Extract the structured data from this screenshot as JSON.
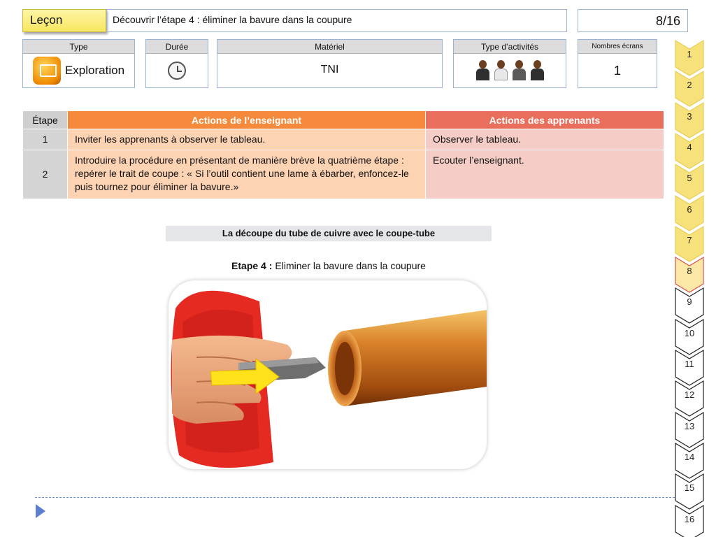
{
  "header": {
    "lecon_label": "Leçon",
    "title": "Découvrir l’étape 4 : éliminer la bavure dans la coupure",
    "page_indicator": "8/16"
  },
  "info": {
    "type": {
      "head": "Type",
      "value": "Exploration",
      "icon": "exploration-icon"
    },
    "duree": {
      "head": "Durée",
      "icon": "alarm-clock-icon"
    },
    "materiel": {
      "head": "Matériel",
      "value": "TNI"
    },
    "activite": {
      "head": "Type d’activités",
      "icon": "group-of-learners-icon"
    },
    "ecrans": {
      "head": "Nombres écrans",
      "value": "1"
    }
  },
  "table": {
    "headers": [
      "Étape",
      "Actions de l’enseignant",
      "Actions des apprenants"
    ],
    "rows": [
      {
        "num": "1",
        "enseignant": "Inviter les apprenants à observer le tableau.",
        "apprenants": "Observer le tableau."
      },
      {
        "num": "2",
        "enseignant": "Introduire la procédure en présentant de manière brève la quatrième étape : repérer le trait de coupe : « Si l’outil contient une lame à ébarber, enfoncez-le puis tournez pour éliminer la bavure.»",
        "apprenants": "Ecouter l’enseignant."
      }
    ]
  },
  "content": {
    "subtitle": "La découpe du tube de cuivre avec le coupe-tube",
    "step_label": "Etape 4 :",
    "step_text": "Eliminer la bavure dans la coupure"
  },
  "nav": {
    "items": [
      "1",
      "2",
      "3",
      "4",
      "5",
      "6",
      "7",
      "8",
      "9",
      "10",
      "11",
      "12",
      "13",
      "14",
      "15",
      "16"
    ],
    "current": "8",
    "colors": {
      "done": "#f7e17a",
      "current": "#fbe7a6",
      "current_border": "#d9534f",
      "todo": "#ffffff"
    }
  }
}
